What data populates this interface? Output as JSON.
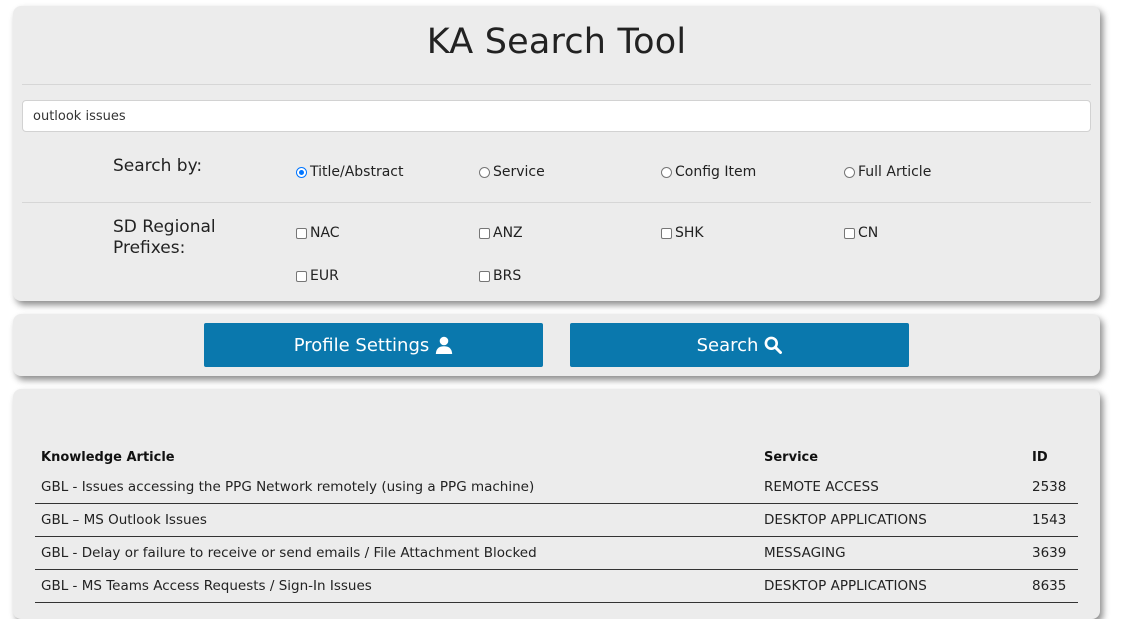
{
  "app": {
    "title": "KA Search Tool"
  },
  "search": {
    "value": "outlook issues",
    "placeholder": ""
  },
  "search_by": {
    "label": "Search by:",
    "options": [
      {
        "label": "Title/Abstract",
        "checked": true
      },
      {
        "label": "Service",
        "checked": false
      },
      {
        "label": "Config Item",
        "checked": false
      },
      {
        "label": "Full Article",
        "checked": false
      }
    ]
  },
  "regional": {
    "label_line1": "SD Regional",
    "label_line2": "Prefixes:",
    "options": [
      {
        "label": "NAC",
        "checked": false
      },
      {
        "label": "ANZ",
        "checked": false
      },
      {
        "label": "SHK",
        "checked": false
      },
      {
        "label": "CN",
        "checked": false
      },
      {
        "label": "EUR",
        "checked": false
      },
      {
        "label": "BRS",
        "checked": false
      }
    ]
  },
  "buttons": {
    "profile_label": "Profile Settings",
    "profile_icon": "user-icon",
    "search_label": "Search",
    "search_icon": "search-icon",
    "color": "#0a78ad"
  },
  "results": {
    "headers": {
      "article": "Knowledge Article",
      "service": "Service",
      "id": "ID"
    },
    "rows": [
      {
        "article": "GBL - Issues accessing the PPG Network remotely (using a PPG machine)",
        "service": "REMOTE ACCESS",
        "id": "2538"
      },
      {
        "article": "GBL – MS Outlook Issues",
        "service": "DESKTOP APPLICATIONS",
        "id": "1543"
      },
      {
        "article": "GBL - Delay or failure to receive or send emails / File Attachment Blocked",
        "service": "MESSAGING",
        "id": "3639"
      },
      {
        "article": "GBL - MS Teams Access Requests / Sign-In Issues",
        "service": "DESKTOP APPLICATIONS",
        "id": "8635"
      }
    ]
  },
  "colors": {
    "link": "#1f7bb1",
    "card_bg": "#ececec",
    "radio_accent": "#0075ff"
  }
}
